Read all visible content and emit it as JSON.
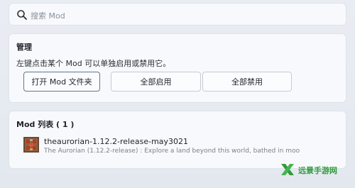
{
  "search": {
    "icon": "search-icon",
    "placeholder": "搜索 Mod"
  },
  "manage": {
    "title": "管理",
    "description": "左键点击某个 Mod 可以单独启用或禁用它。",
    "buttons": {
      "open_folder": "打开 Mod 文件夹",
      "enable_all": "全部启用",
      "disable_all": "全部禁用"
    }
  },
  "mod_list": {
    "title": "Mod 列表 ( 1 )",
    "items": [
      {
        "icon": "redstone-block-icon",
        "name": "theaurorian-1.12.2-release-may3021",
        "description": "The Aurorian (1.12.2-release) : Explore a land beyond this world, bathed in moo"
      }
    ]
  },
  "watermark": {
    "text": "远景手游网",
    "icon": "x-logo-icon",
    "color": "#2f9d3a"
  },
  "colors": {
    "background": "#e6ebf1",
    "card": "#f7f9fc",
    "primary_border": "#5e7891"
  }
}
